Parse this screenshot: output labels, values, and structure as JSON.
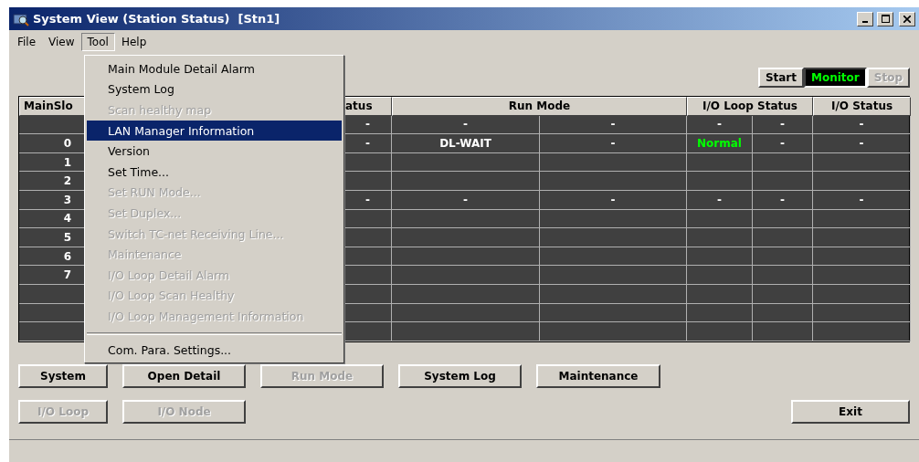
{
  "window": {
    "title": "System View (Station Status)  [Stn1]"
  },
  "menu_bar": [
    {
      "label": "File",
      "selected": false
    },
    {
      "label": "View",
      "selected": false
    },
    {
      "label": "Tool",
      "selected": true
    },
    {
      "label": "Help",
      "selected": false
    }
  ],
  "tool_menu": [
    {
      "label": "Main Module Detail Alarm",
      "disabled": false,
      "selected": false
    },
    {
      "label": "System Log",
      "disabled": false,
      "selected": false
    },
    {
      "label": "Scan healthy map",
      "disabled": true,
      "selected": false
    },
    {
      "label": "LAN Manager Information",
      "disabled": false,
      "selected": true
    },
    {
      "label": "Version",
      "disabled": false,
      "selected": false
    },
    {
      "label": "Set Time...",
      "disabled": false,
      "selected": false
    },
    {
      "label": "Set RUN Mode...",
      "disabled": true,
      "selected": false
    },
    {
      "label": "Set Duplex...",
      "disabled": true,
      "selected": false
    },
    {
      "label": "Switch TC-net Receiving Line...",
      "disabled": true,
      "selected": false
    },
    {
      "label": "Maintenance",
      "disabled": true,
      "selected": false
    },
    {
      "label": "I/O Loop Detail Alarm",
      "disabled": true,
      "selected": false
    },
    {
      "label": "I/O Loop Scan Healthy",
      "disabled": true,
      "selected": false
    },
    {
      "label": "I/O Loop Management Information",
      "disabled": true,
      "selected": false,
      "separator_after": true
    },
    {
      "label": "Com. Para. Settings...",
      "disabled": false,
      "selected": false
    }
  ],
  "mode_buttons": [
    {
      "label": "Start",
      "selected": false,
      "disabled": false
    },
    {
      "label": "Monitor",
      "selected": true,
      "disabled": false
    },
    {
      "label": "Stop",
      "selected": false,
      "disabled": true
    }
  ],
  "table": {
    "columns": [
      "MainSlo",
      "atus",
      "Run Mode",
      "I/O Loop Status",
      "I/O Status"
    ],
    "rows": [
      {
        "cells": [
          "-",
          "-",
          "-",
          "-",
          "-",
          "-"
        ]
      },
      {
        "slot": "0",
        "cells": [
          "-",
          "DL-WAIT",
          "-",
          {
            "text": "Normal",
            "color": "#00ff00"
          },
          "-",
          "-"
        ]
      },
      {
        "slot": "1"
      },
      {
        "slot": "2"
      },
      {
        "slot": "3",
        "cells": [
          "-",
          "-",
          "-",
          "-",
          "-",
          "-"
        ]
      },
      {
        "slot": "4"
      },
      {
        "slot": "5"
      },
      {
        "slot": "6"
      },
      {
        "slot": "7"
      },
      {},
      {},
      {}
    ]
  },
  "buttons": [
    [
      {
        "label": "System",
        "disabled": false
      },
      {
        "label": "Open Detail",
        "disabled": false
      },
      {
        "label": "Run Mode",
        "disabled": true
      },
      {
        "label": "System Log",
        "disabled": false
      },
      {
        "label": "Maintenance",
        "disabled": false
      }
    ],
    [
      {
        "label": "I/O Loop",
        "disabled": true
      },
      {
        "label": "I/O Node",
        "disabled": true
      },
      {
        "label": "Exit",
        "disabled": false
      }
    ]
  ]
}
